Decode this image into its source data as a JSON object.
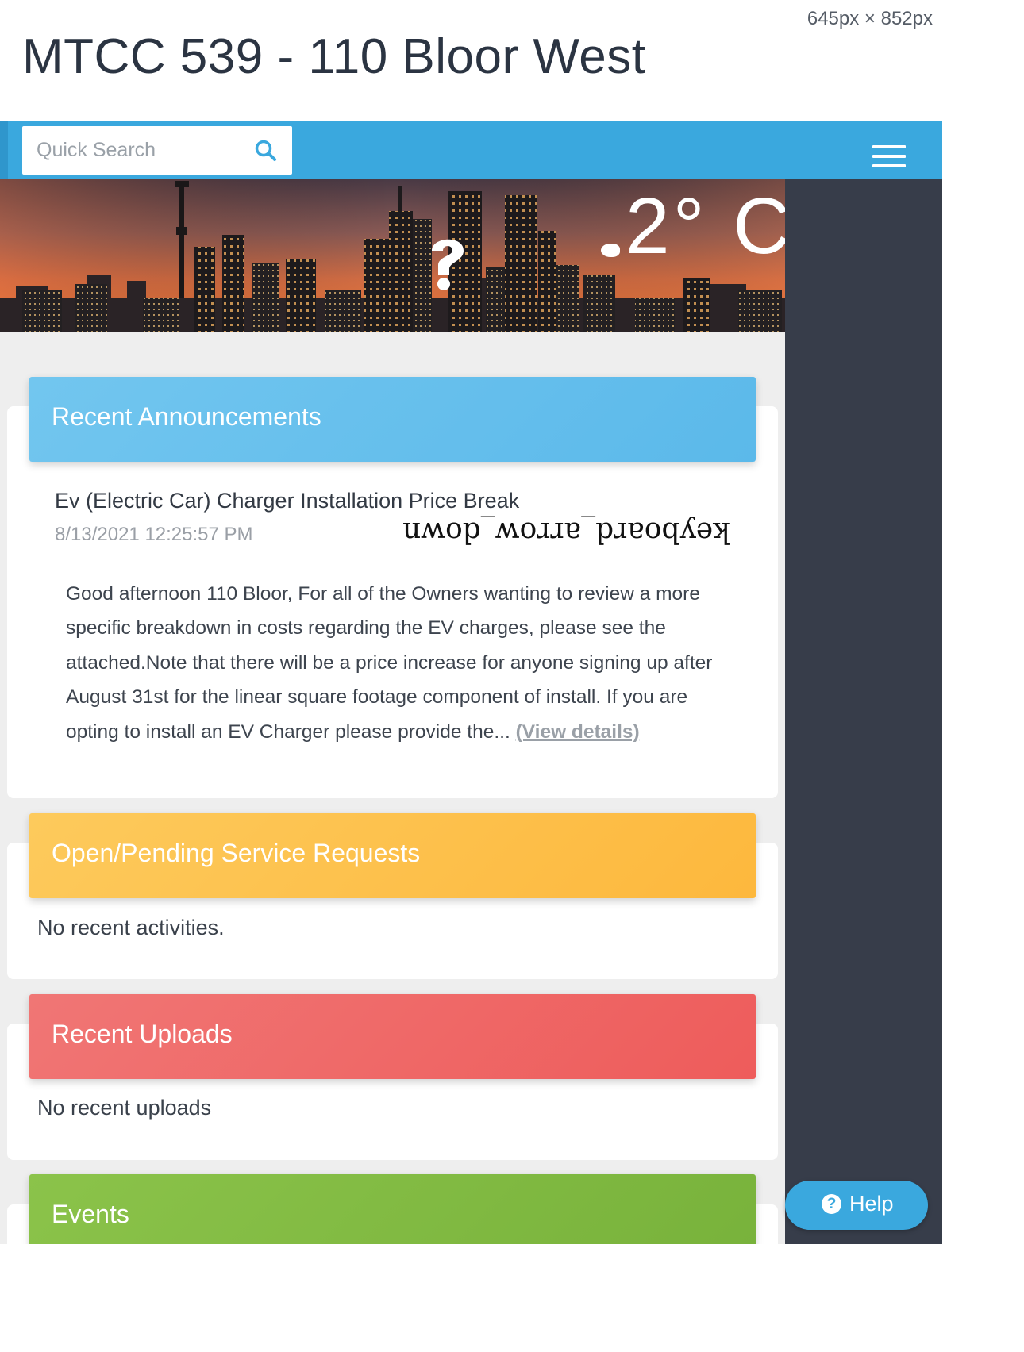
{
  "header": {
    "dimensions_readout": "645px × 852px",
    "site_title": "MTCC 539 - 110 Bloor West"
  },
  "search": {
    "placeholder": "Quick Search",
    "value": ""
  },
  "icons": {
    "search": "search-icon",
    "menu": "hamburger-menu-icon",
    "weather": "weather-icon",
    "help": "question-circle-icon"
  },
  "weather": {
    "temperature": "2° C"
  },
  "colors": {
    "topbar": "#3aa8de",
    "side_panel": "#373d4a",
    "announcements_header": "#5bb9ea",
    "service_requests_header": "#fdb83d",
    "uploads_header": "#ee5c5b",
    "events_header": "#8bc34a"
  },
  "announcements": {
    "header": "Recent Announcements",
    "items": [
      {
        "title": "Ev (Electric Car) Charger Installation Price Break",
        "date": "8/13/2021 12:25:57 PM",
        "toggle_label": "keyboard_arrow_down",
        "body": "Good afternoon 110 Bloor, For all of the Owners wanting to review a more specific breakdown in costs regarding the EV charges, please see the attached.Note that there will be a price increase for anyone signing up after August 31st for the linear square footage component of install. If you are opting to install an EV Charger please provide the...",
        "link_label": "(View details)"
      }
    ]
  },
  "service_requests": {
    "header": "Open/Pending Service Requests",
    "empty_text": "No recent activities."
  },
  "uploads": {
    "header": "Recent Uploads",
    "empty_text": "No recent uploads"
  },
  "events": {
    "header": "Events"
  },
  "help": {
    "label": "Help"
  }
}
